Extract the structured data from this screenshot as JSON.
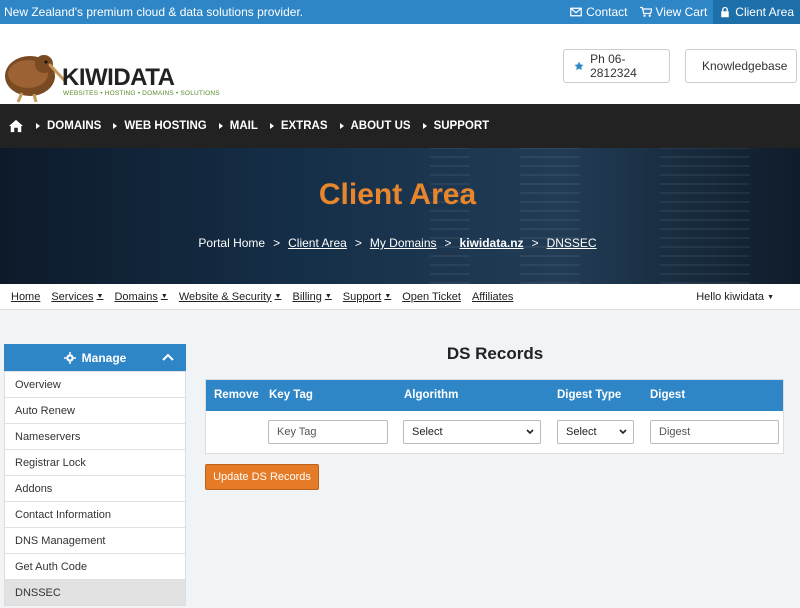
{
  "topbar": {
    "tagline": "New Zealand's premium cloud & data solutions provider.",
    "links": [
      {
        "label": "Contact",
        "icon": "envelope-icon"
      },
      {
        "label": "View Cart",
        "icon": "cart-icon"
      },
      {
        "label": "Client Area",
        "icon": "lock-icon"
      }
    ]
  },
  "header": {
    "logo_text": "KIWIDATA",
    "logo_tagline": "WEBSITES • HOSTING • DOMAINS • SOLUTIONS",
    "phone_label": "Ph 06-2812324",
    "kb_label": "Knowledgebase"
  },
  "nav": {
    "items": [
      "DOMAINS",
      "WEB HOSTING",
      "MAIL",
      "EXTRAS",
      "ABOUT US",
      "SUPPORT"
    ]
  },
  "banner": {
    "title": "Client Area",
    "breadcrumbs": [
      "Portal Home",
      "Client Area",
      "My Domains",
      "kiwidata.nz",
      "DNSSEC"
    ],
    "separator": ">"
  },
  "subnav": {
    "items": [
      "Home",
      "Services",
      "Domains",
      "Website & Security",
      "Billing",
      "Support",
      "Open Ticket",
      "Affiliates"
    ],
    "user": "Hello kiwidata"
  },
  "sidebar": {
    "title": "Manage",
    "items": [
      "Overview",
      "Auto Renew",
      "Nameservers",
      "Registrar Lock",
      "Addons",
      "Contact Information",
      "DNS Management",
      "Get Auth Code",
      "DNSSEC"
    ],
    "active": "DNSSEC"
  },
  "content": {
    "heading": "DS Records",
    "columns": [
      "Remove",
      "Key Tag",
      "Algorithm",
      "Digest Type",
      "Digest"
    ],
    "keytag_placeholder": "Key Tag",
    "algorithm_value": "Select",
    "digest_type_value": "Select",
    "digest_placeholder": "Digest",
    "update_button": "Update DS Records"
  },
  "colors": {
    "primary": "#2f86c6",
    "accent": "#e57b26",
    "nav_bg": "#222222"
  }
}
